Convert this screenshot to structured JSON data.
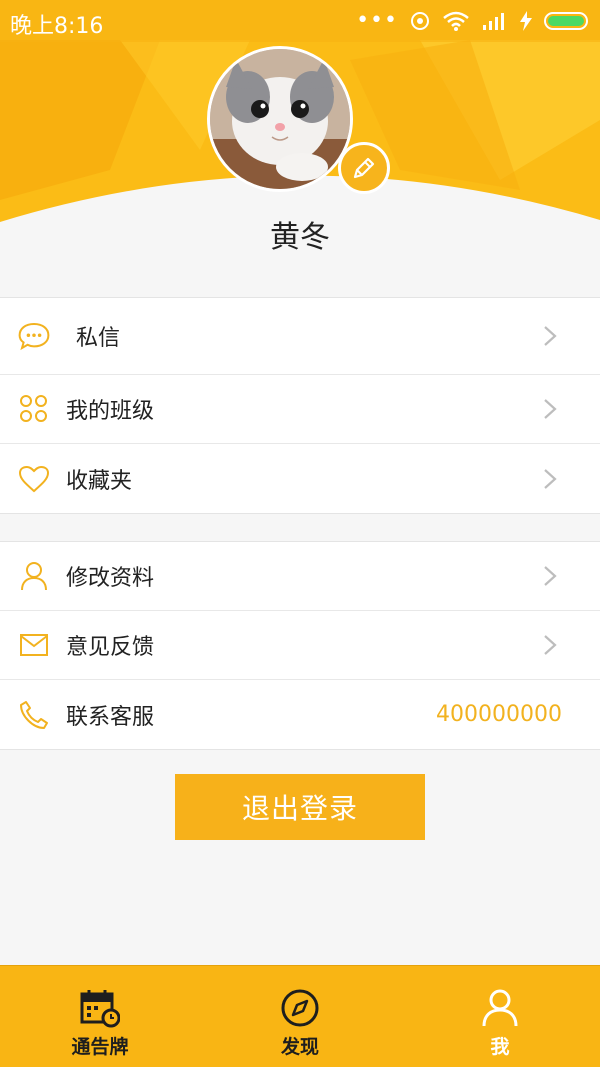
{
  "status_bar": {
    "time": "晚上8:16"
  },
  "profile": {
    "name": "黄冬"
  },
  "menu_group_1": [
    {
      "label": "私信",
      "icon": "chat-icon"
    },
    {
      "label": "我的班级",
      "icon": "grid-icon"
    },
    {
      "label": "收藏夹",
      "icon": "heart-icon"
    }
  ],
  "menu_group_2": [
    {
      "label": "修改资料",
      "icon": "user-icon"
    },
    {
      "label": "意见反馈",
      "icon": "mail-icon"
    },
    {
      "label": "联系客服",
      "icon": "phone-icon",
      "value": "400000000"
    }
  ],
  "logout_label": "退出登录",
  "tabs": [
    {
      "label": "通告牌",
      "icon": "calendar-icon"
    },
    {
      "label": "发现",
      "icon": "compass-icon"
    },
    {
      "label": "我",
      "icon": "person-icon",
      "active": true
    }
  ],
  "colors": {
    "accent": "#f7b11a",
    "header_light": "#ffd23a",
    "text": "#222222"
  }
}
